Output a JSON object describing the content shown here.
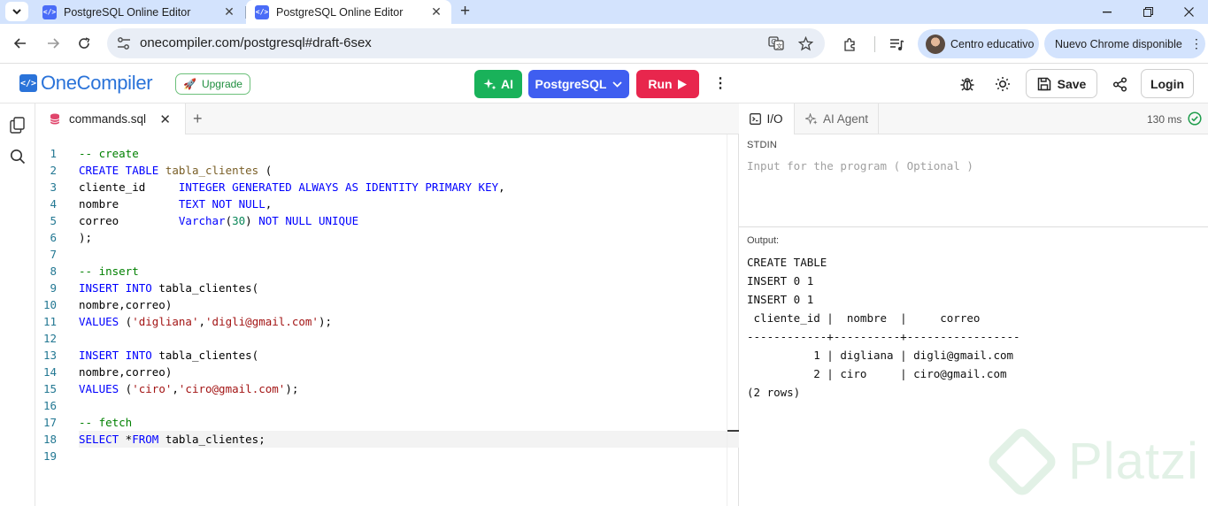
{
  "browser": {
    "tabs": [
      {
        "title": "PostgreSQL Online Editor",
        "active": false
      },
      {
        "title": "PostgreSQL Online Editor",
        "active": true
      }
    ],
    "url": "onecompiler.com/postgresql#draft-6sex",
    "profile_label": "Centro educativo",
    "update_label": "Nuevo Chrome disponible"
  },
  "app": {
    "logo_text": "OneCompiler",
    "upgrade_label": "Upgrade",
    "ai_label": "AI",
    "language_label": "PostgreSQL",
    "run_label": "Run",
    "save_label": "Save",
    "login_label": "Login"
  },
  "editor": {
    "file_tab": "commands.sql",
    "lines": [
      "1",
      "2",
      "3",
      "4",
      "5",
      "6",
      "7",
      "8",
      "9",
      "10",
      "11",
      "12",
      "13",
      "14",
      "15",
      "16",
      "17",
      "18",
      "19"
    ],
    "code": {
      "l1": "-- create",
      "l2_kw": "CREATE TABLE",
      "l2_name": "tabla_clientes",
      "l2_rest": " (",
      "l3_col": "cliente_id     ",
      "l3_type": "INTEGER GENERATED ALWAYS AS IDENTITY PRIMARY KEY",
      "l3_rest": ",",
      "l4_col": "nombre         ",
      "l4_type": "TEXT NOT NULL",
      "l4_rest": ",",
      "l5_col": "correo         ",
      "l5_type": "Varchar",
      "l5_p1": "(",
      "l5_num": "30",
      "l5_p2": ") ",
      "l5_kw": "NOT NULL UNIQUE",
      "l6": ");",
      "l8": "-- insert",
      "l9_kw": "INSERT INTO",
      "l9_rest": " tabla_clientes(",
      "l10": "nombre,correo)",
      "l11_kw": "VALUES",
      "l11_a": " (",
      "l11_s1": "'digliana'",
      "l11_b": ",",
      "l11_s2": "'digli@gmail.com'",
      "l11_c": ");",
      "l13_kw": "INSERT INTO",
      "l13_rest": " tabla_clientes(",
      "l14": "nombre,correo)",
      "l15_kw": "VALUES",
      "l15_a": " (",
      "l15_s1": "'ciro'",
      "l15_b": ",",
      "l15_s2": "'ciro@gmail.com'",
      "l15_c": ");",
      "l17": "-- fetch",
      "l18_kw1": "SELECT",
      "l18_op": " *",
      "l18_kw2": "FROM",
      "l18_rest": " tabla_clientes;"
    }
  },
  "io": {
    "tab_io": "I/O",
    "tab_agent": "AI Agent",
    "exec_time": "130 ms",
    "stdin_label": "STDIN",
    "stdin_placeholder": "Input for the program ( Optional )",
    "output_label": "Output:",
    "output_lines": [
      "CREATE TABLE",
      "INSERT 0 1",
      "INSERT 0 1",
      " cliente_id |  nombre  |     correo",
      "------------+----------+-----------------",
      "          1 | digliana | digli@gmail.com",
      "          2 | ciro     | ciro@gmail.com",
      "(2 rows)"
    ]
  },
  "watermark": "Platzi",
  "colors": {
    "ai_button": "#19b25a",
    "language_button": "#3f5ef0",
    "run_button": "#e8264d",
    "brand": "#2a73d9"
  }
}
